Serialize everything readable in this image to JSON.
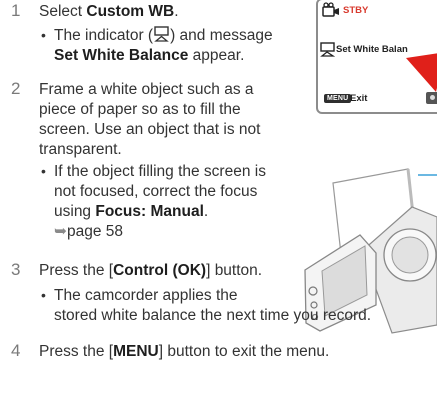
{
  "steps": [
    {
      "number": "1",
      "text_pre": "Select ",
      "text_bold": "Custom WB",
      "text_post": ".",
      "bullet_line1_pre": "The indicator (",
      "bullet_line1_post": ") and message",
      "bullet_line2_bold": "Set White Balance",
      "bullet_line2_post": " appear."
    },
    {
      "number": "2",
      "lines": [
        "Frame a white object such as a",
        "piece of paper so as to fill the",
        "screen. Use an object that is not",
        "transparent."
      ],
      "bullet_lines": [
        "If the object filling the screen is",
        "not focused, correct the focus"
      ],
      "bullet_line3_pre": "using ",
      "bullet_line3_bold": "Focus: Manual",
      "bullet_line3_post": ".",
      "page_ref": "page 58"
    },
    {
      "number": "3",
      "text_pre": "Press the [",
      "text_bold": "Control (OK)",
      "text_post": "] button.",
      "bullet_line1": "The camcorder applies the",
      "bullet_line2": "stored white balance the next time you record."
    },
    {
      "number": "4",
      "text_pre": "Press the [",
      "text_bold": "MENU",
      "text_post": "] button to exit the menu."
    }
  ],
  "lcd": {
    "status": "STBY",
    "message": "Set White Balan",
    "menu_badge": "MENU",
    "exit_label": "Exit"
  },
  "colors": {
    "arrow_red": "#e0201a",
    "accent_blue": "#3aa0d8"
  }
}
